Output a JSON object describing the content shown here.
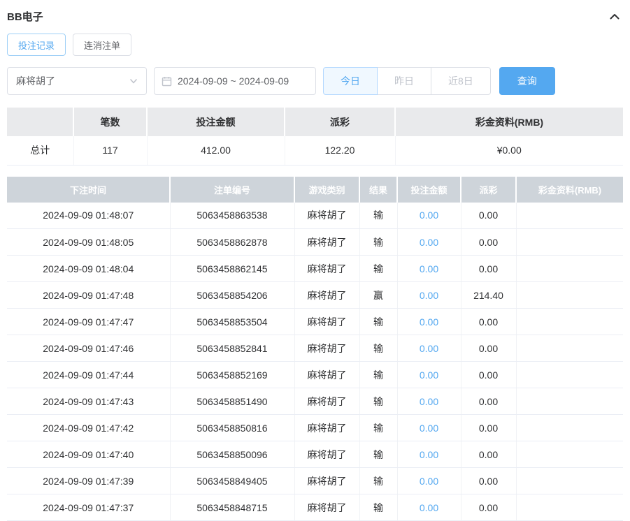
{
  "colors": {
    "accent": "#54a8f0",
    "table_header_bg": "#ced4da",
    "summary_header_bg": "#e9eaec"
  },
  "header": {
    "title": "BB电子"
  },
  "tabs": [
    {
      "label": "投注记录"
    },
    {
      "label": "连消注单"
    }
  ],
  "filters": {
    "game_select": "麻将胡了",
    "date_range": "2024-09-09 ~ 2024-09-09",
    "quick": [
      {
        "label": "今日"
      },
      {
        "label": "昨日"
      },
      {
        "label": "近8日"
      }
    ],
    "search_label": "查询"
  },
  "summary": {
    "total_label": "总计",
    "headers": [
      "笔数",
      "投注金额",
      "派彩",
      "彩金资料(RMB)"
    ],
    "values": [
      "117",
      "412.00",
      "122.20",
      "¥0.00"
    ]
  },
  "table": {
    "headers": [
      "下注时间",
      "注单编号",
      "游戏类别",
      "结果",
      "投注金额",
      "派彩",
      "彩金资料(RMB)"
    ],
    "rows": [
      [
        "2024-09-09 01:48:07",
        "5063458863538",
        "麻将胡了",
        "输",
        "0.00",
        "0.00",
        ""
      ],
      [
        "2024-09-09 01:48:05",
        "5063458862878",
        "麻将胡了",
        "输",
        "0.00",
        "0.00",
        ""
      ],
      [
        "2024-09-09 01:48:04",
        "5063458862145",
        "麻将胡了",
        "输",
        "0.00",
        "0.00",
        ""
      ],
      [
        "2024-09-09 01:47:48",
        "5063458854206",
        "麻将胡了",
        "赢",
        "0.00",
        "214.40",
        ""
      ],
      [
        "2024-09-09 01:47:47",
        "5063458853504",
        "麻将胡了",
        "输",
        "0.00",
        "0.00",
        ""
      ],
      [
        "2024-09-09 01:47:46",
        "5063458852841",
        "麻将胡了",
        "输",
        "0.00",
        "0.00",
        ""
      ],
      [
        "2024-09-09 01:47:44",
        "5063458852169",
        "麻将胡了",
        "输",
        "0.00",
        "0.00",
        ""
      ],
      [
        "2024-09-09 01:47:43",
        "5063458851490",
        "麻将胡了",
        "输",
        "0.00",
        "0.00",
        ""
      ],
      [
        "2024-09-09 01:47:42",
        "5063458850816",
        "麻将胡了",
        "输",
        "0.00",
        "0.00",
        ""
      ],
      [
        "2024-09-09 01:47:40",
        "5063458850096",
        "麻将胡了",
        "输",
        "0.00",
        "0.00",
        ""
      ],
      [
        "2024-09-09 01:47:39",
        "5063458849405",
        "麻将胡了",
        "输",
        "0.00",
        "0.00",
        ""
      ],
      [
        "2024-09-09 01:47:37",
        "5063458848715",
        "麻将胡了",
        "输",
        "0.00",
        "0.00",
        ""
      ]
    ]
  }
}
